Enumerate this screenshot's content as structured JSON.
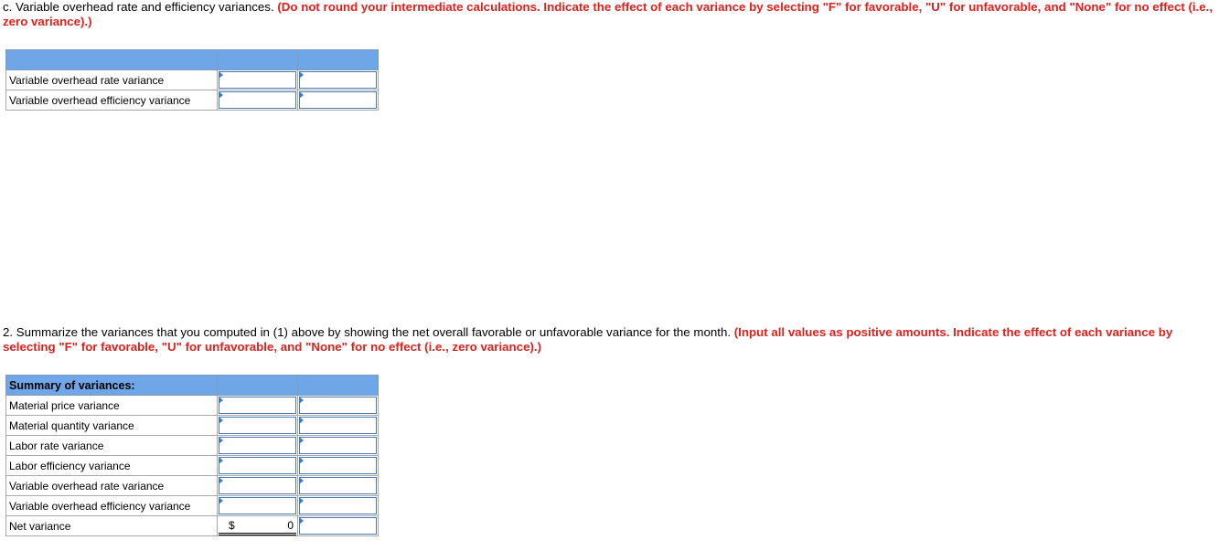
{
  "part_c": {
    "instruction_plain": "c. Variable overhead rate and efficiency variances. ",
    "instruction_red": "(Do not round your intermediate calculations. Indicate the effect of each variance by selecting \"F\" for favorable, \"U\" for unfavorable, and \"None\" for no effect (i.e., zero variance).)",
    "table": {
      "header": "",
      "rows": [
        {
          "label": "Variable overhead rate variance",
          "amount": "",
          "effect": ""
        },
        {
          "label": "Variable overhead efficiency variance",
          "amount": "",
          "effect": ""
        }
      ]
    }
  },
  "part_2": {
    "instruction_plain": "2. Summarize the variances that you computed in (1) above by showing the net overall favorable or unfavorable variance for the month. ",
    "instruction_red": "(Input all values as positive amounts. Indicate the effect of each variance by selecting \"F\" for favorable, \"U\" for unfavorable, and \"None\" for no effect (i.e., zero variance).)",
    "table": {
      "header": "Summary of variances:",
      "rows": [
        {
          "label": "Material price variance",
          "amount": "",
          "effect": ""
        },
        {
          "label": "Material quantity variance",
          "amount": "",
          "effect": ""
        },
        {
          "label": "Labor rate variance",
          "amount": "",
          "effect": ""
        },
        {
          "label": "Labor efficiency variance",
          "amount": "",
          "effect": ""
        },
        {
          "label": "Variable overhead rate variance",
          "amount": "",
          "effect": ""
        },
        {
          "label": "Variable overhead efficiency variance",
          "amount": "",
          "effect": ""
        }
      ],
      "net": {
        "label": "Net variance",
        "currency": "$",
        "value": "0",
        "effect": ""
      }
    }
  },
  "colors": {
    "instruction_red": "#e0201b",
    "header_blue": "#6ea6e8",
    "input_border": "#4a78b8"
  }
}
